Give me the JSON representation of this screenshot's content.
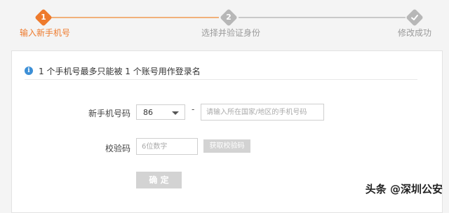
{
  "steps": [
    {
      "number": "1",
      "label": "输入新手机号",
      "state": "active"
    },
    {
      "number": "2",
      "label": "选择并验证身份",
      "state": "inactive"
    },
    {
      "icon": "check-icon",
      "label": "修改成功",
      "state": "inactive"
    }
  ],
  "notice": {
    "icon": "info-icon",
    "icon_glyph": "i",
    "text": "1 个手机号最多只能被 1 个账号用作登录名"
  },
  "form": {
    "phone_label": "新手机号码",
    "country_code": "86",
    "separator": "-",
    "phone_placeholder": "请输入所在国家/地区的手机号码",
    "code_label": "校验码",
    "code_placeholder": "6位数字",
    "get_code_button": "获取校验码",
    "confirm_button": "确 定"
  },
  "watermark": "头条 @深圳公安",
  "colors": {
    "accent": "#ee7a2c",
    "inactive": "#b7b7b7",
    "info": "#3c8fd6",
    "button_disabled": "#d3d3d3"
  }
}
